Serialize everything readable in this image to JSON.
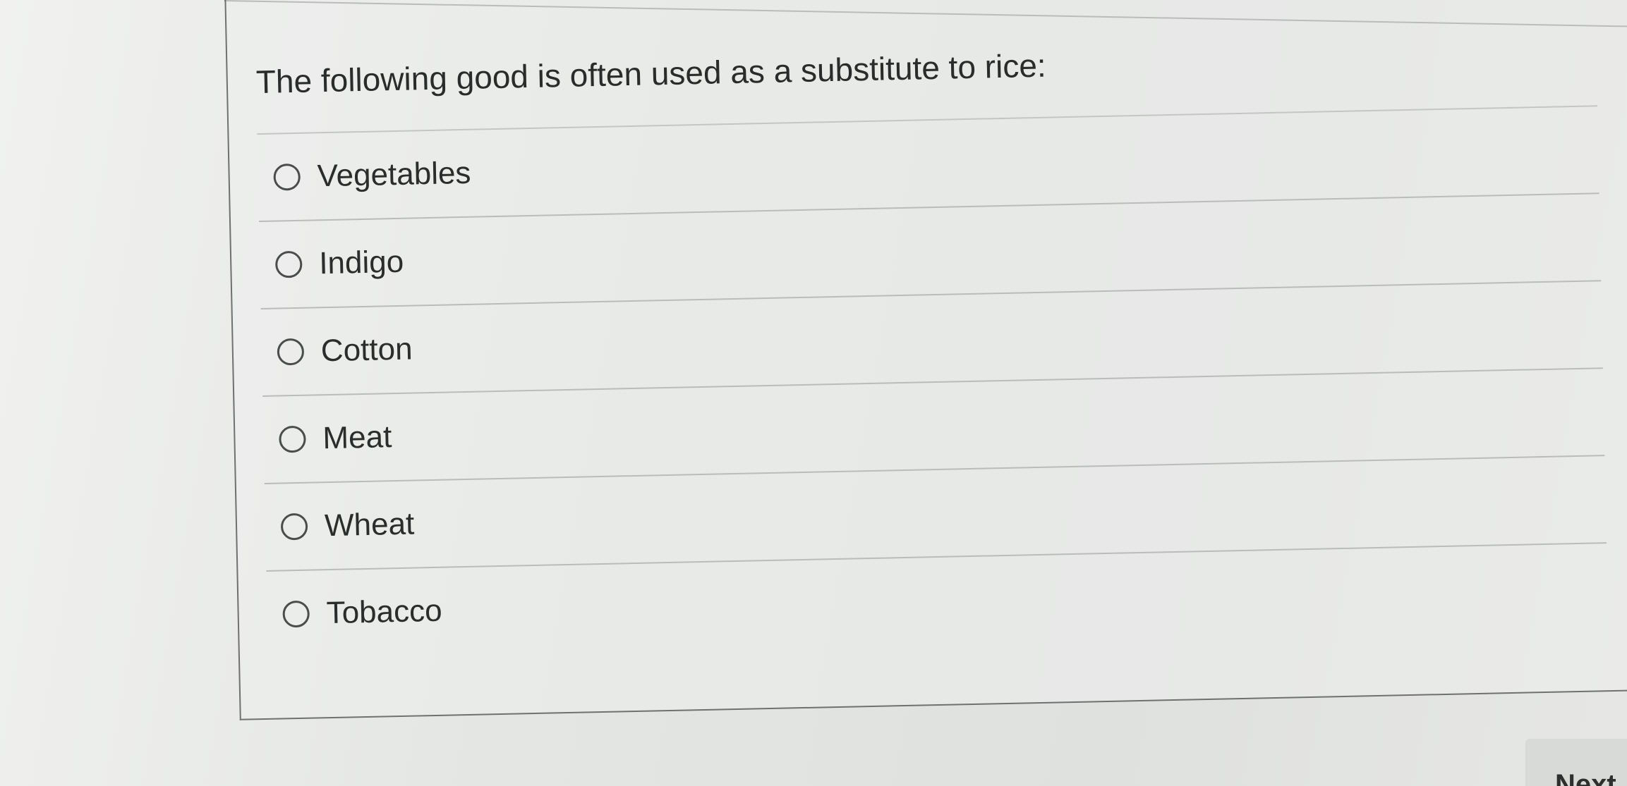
{
  "question": {
    "prompt": "The following good is often used as a substitute to rice:"
  },
  "options": [
    {
      "label": "Vegetables"
    },
    {
      "label": "Indigo"
    },
    {
      "label": "Cotton"
    },
    {
      "label": "Meat"
    },
    {
      "label": "Wheat"
    },
    {
      "label": "Tobacco"
    }
  ],
  "footer": {
    "next_label": "Next"
  }
}
